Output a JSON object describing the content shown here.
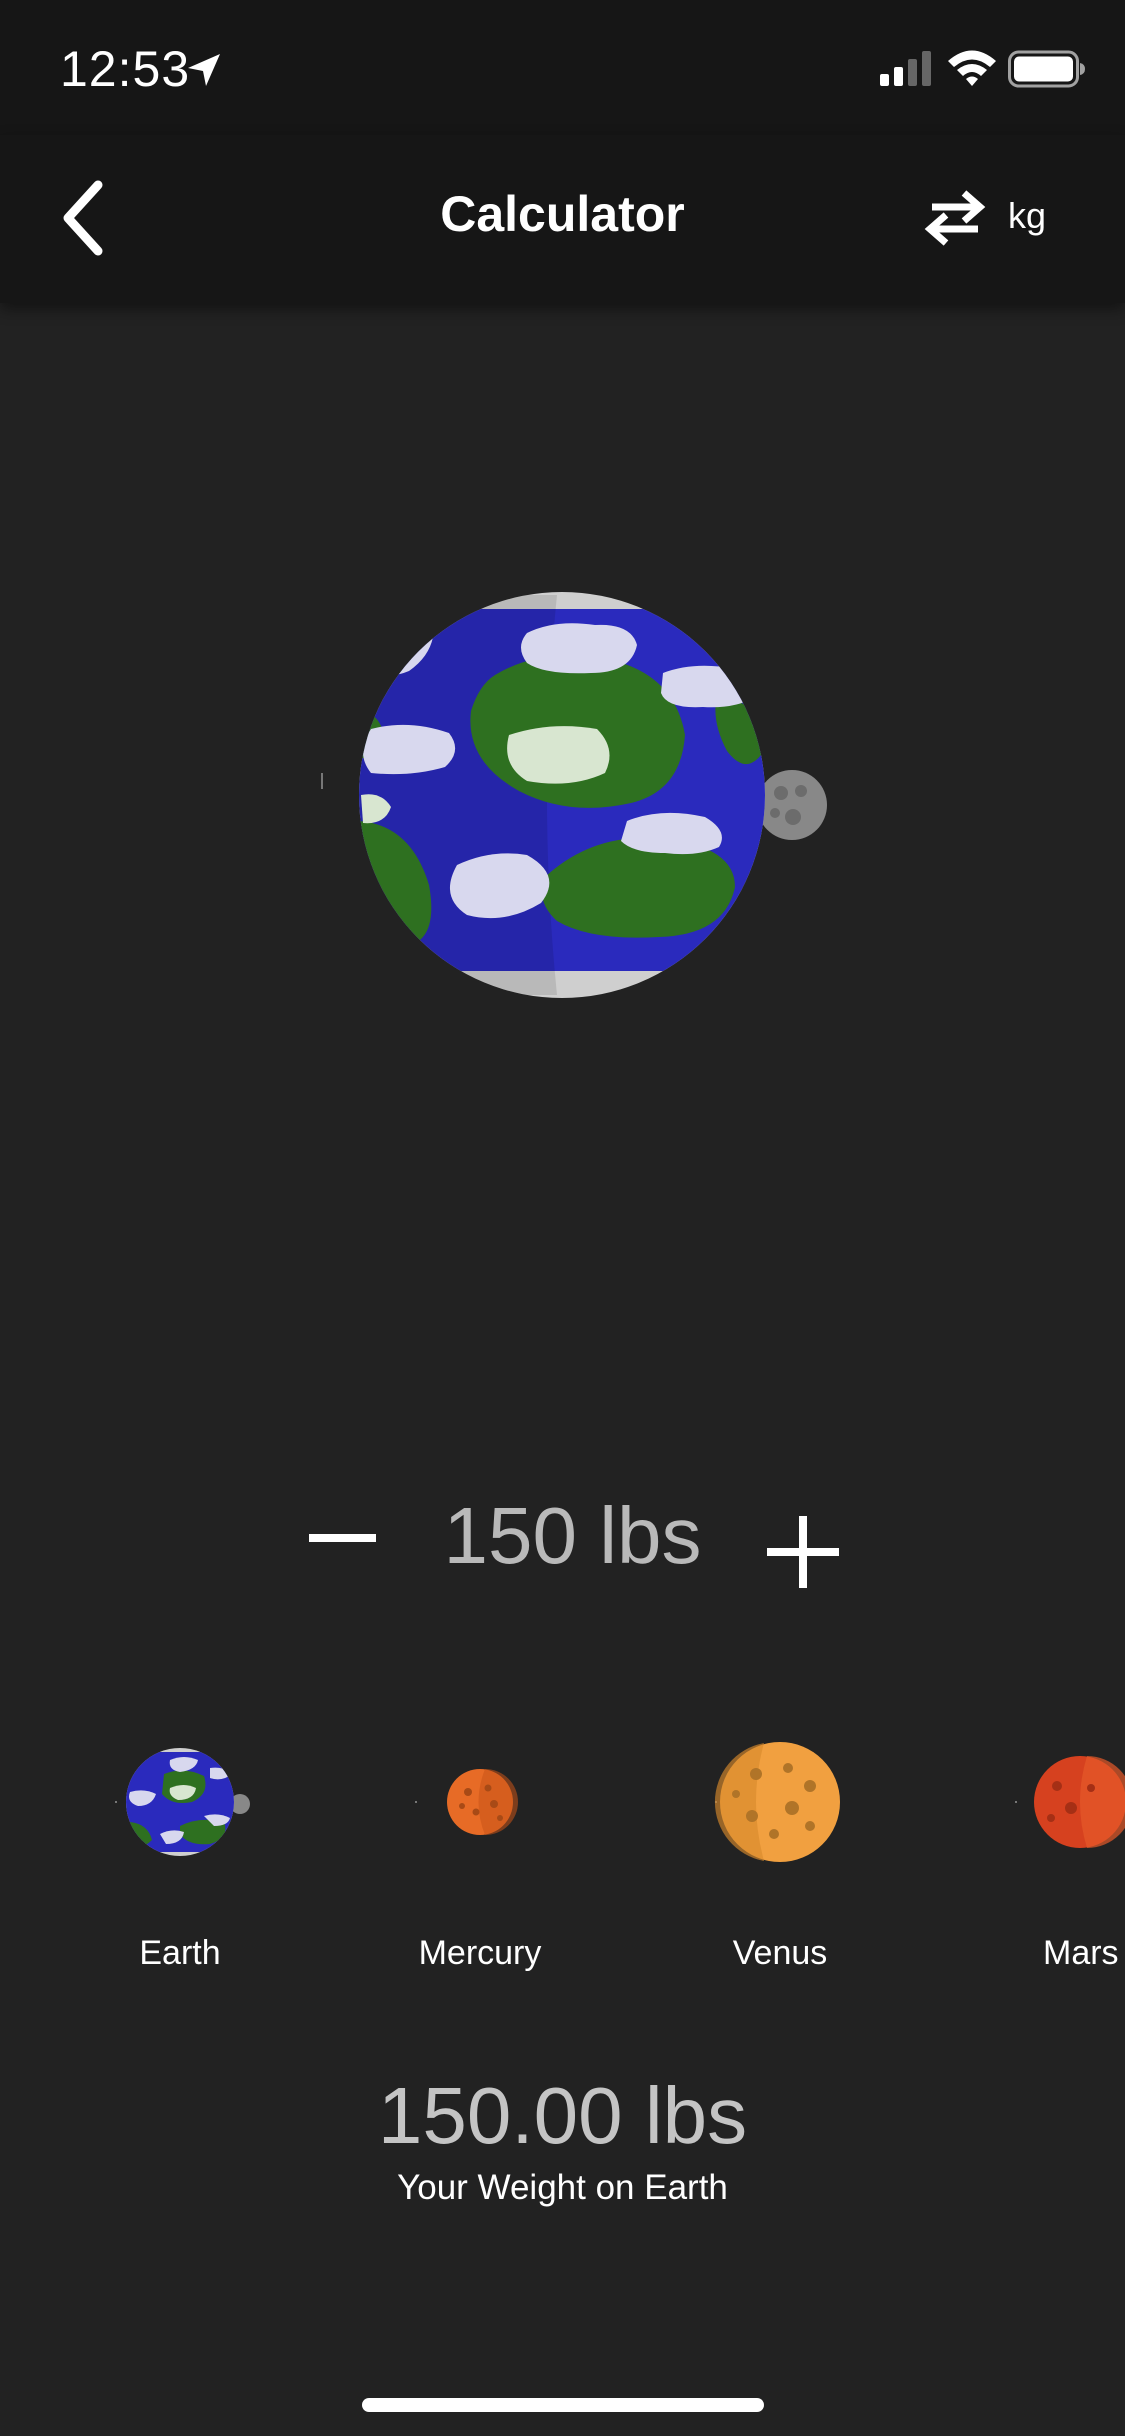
{
  "status_bar": {
    "time": "12:53",
    "icons": [
      "location-arrow-icon",
      "cellular-signal-icon",
      "wifi-icon",
      "battery-icon"
    ]
  },
  "nav": {
    "back_icon": "chevron-left-icon",
    "title": "Calculator",
    "swap_icon": "swap-arrows-icon",
    "unit_toggle": "kg"
  },
  "hero": {
    "planet": "Earth"
  },
  "stepper": {
    "value": "150 lbs",
    "minus_icon": "minus-icon",
    "plus_icon": "plus-icon"
  },
  "planets": [
    {
      "name": "Earth",
      "icon": "earth-icon"
    },
    {
      "name": "Mercury",
      "icon": "mercury-icon"
    },
    {
      "name": "Venus",
      "icon": "venus-icon"
    },
    {
      "name": "Mars",
      "icon": "mars-icon"
    }
  ],
  "result": {
    "value": "150.00 lbs",
    "caption": "Your Weight on Earth"
  },
  "colors": {
    "background": "#222222",
    "bar": "#161616",
    "ocean": "#2a2abd",
    "land": "#2e7020",
    "mercury": "#e76b26",
    "venus": "#f1a040",
    "mars": "#d6411f"
  }
}
